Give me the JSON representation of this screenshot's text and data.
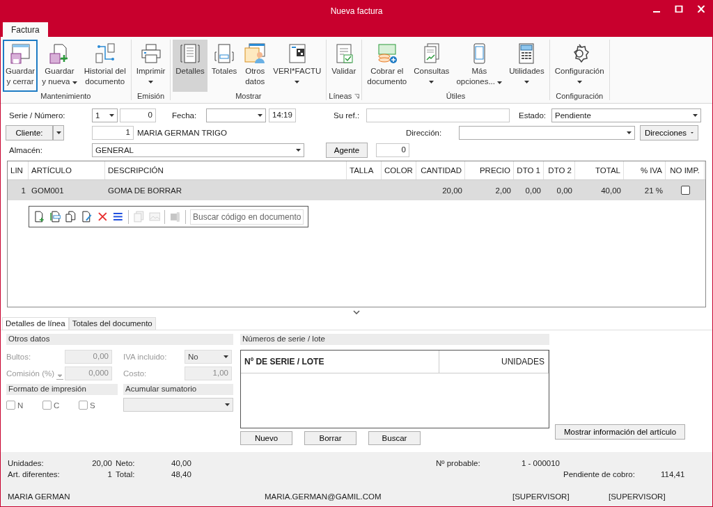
{
  "window": {
    "title": "Nueva factura"
  },
  "ribbon_tabs": [
    {
      "label": "Factura",
      "selected": true
    }
  ],
  "ribbon": [
    {
      "label": "Mantenimiento",
      "launcher": false,
      "buttons": [
        {
          "lines": [
            "Guardar",
            "y cerrar"
          ],
          "menu": false,
          "focused": true,
          "pressed": false
        },
        {
          "lines": [
            "Guardar",
            "y nueva"
          ],
          "menu": true,
          "focused": false,
          "pressed": false
        },
        {
          "lines": [
            "Historial del",
            "documento"
          ],
          "menu": false,
          "focused": false,
          "pressed": false
        }
      ]
    },
    {
      "label": "Emisión",
      "launcher": false,
      "buttons": [
        {
          "lines": [
            "Imprimir"
          ],
          "menu": true,
          "focused": false,
          "pressed": false
        }
      ]
    },
    {
      "label": "Mostrar",
      "launcher": false,
      "buttons": [
        {
          "lines": [
            "Detalles"
          ],
          "menu": false,
          "focused": false,
          "pressed": true
        },
        {
          "lines": [
            "Totales"
          ],
          "menu": false,
          "focused": false,
          "pressed": false
        },
        {
          "lines": [
            "Otros",
            "datos"
          ],
          "menu": false,
          "focused": false,
          "pressed": false
        },
        {
          "lines": [
            "VERI*FACTU"
          ],
          "menu": true,
          "focused": false,
          "pressed": false
        }
      ]
    },
    {
      "label": "Líneas",
      "launcher": true,
      "buttons": [
        {
          "lines": [
            "Validar"
          ],
          "menu": false,
          "focused": false,
          "pressed": false
        }
      ]
    },
    {
      "label": "Útiles",
      "launcher": false,
      "buttons": [
        {
          "lines": [
            "Cobrar el",
            "documento"
          ],
          "menu": false,
          "focused": false,
          "pressed": false
        },
        {
          "lines": [
            "Consultas"
          ],
          "menu": true,
          "focused": false,
          "pressed": false
        },
        {
          "lines": [
            "Más",
            "opciones..."
          ],
          "menu": true,
          "focused": false,
          "pressed": false
        },
        {
          "lines": [
            "Utilidades"
          ],
          "menu": true,
          "focused": false,
          "pressed": false
        }
      ]
    },
    {
      "label": "Configuración",
      "launcher": false,
      "buttons": [
        {
          "lines": [
            "Configuración"
          ],
          "menu": true,
          "focused": false,
          "pressed": false
        }
      ]
    }
  ],
  "header": {
    "serie_label": "Serie / Número:",
    "serie": "1",
    "numero": "0",
    "fecha_label": "Fecha:",
    "hora": "14:19",
    "su_ref_label": "Su ref.:",
    "estado_label": "Estado:",
    "estado": "Pendiente",
    "cliente_button": "Cliente:",
    "cliente_codigo": "1",
    "cliente_nombre": "MARIA GERMAN TRIGO",
    "direccion_label": "Dirección:",
    "direcciones_button": "Direcciones",
    "almacen_label": "Almacén:",
    "almacen": "GENERAL",
    "agente_button": "Agente",
    "agente": "0"
  },
  "lines_table": {
    "columns": [
      {
        "label": "LIN"
      },
      {
        "label": "ARTÍCULO"
      },
      {
        "label": "DESCRIPCIÓN"
      },
      {
        "label": "TALLA"
      },
      {
        "label": "COLOR"
      },
      {
        "label": "CANTIDAD"
      },
      {
        "label": "PRECIO"
      },
      {
        "label": "DTO 1"
      },
      {
        "label": "DTO 2"
      },
      {
        "label": "TOTAL"
      },
      {
        "label": "% IVA"
      },
      {
        "label": "NO IMP."
      }
    ],
    "rows": [
      {
        "lin": "1",
        "articulo": "GOM001",
        "descripcion": "GOMA DE BORRAR",
        "cantidad": "20,00",
        "precio": "2,00",
        "dto_1": "0,00",
        "dto_2": "0,00",
        "total": "40,00",
        "iva": "21 %",
        "no_imp": false,
        "selected": true
      }
    ],
    "tools": [
      {
        "disabled": false
      },
      {
        "disabled": false
      },
      {
        "disabled": false
      },
      {
        "disabled": false
      },
      {
        "disabled": false
      },
      {
        "disabled": false
      },
      {
        "disabled": true
      },
      {
        "disabled": true
      },
      {
        "disabled": true
      }
    ],
    "search": {
      "placeholder": "Buscar código en documento"
    }
  },
  "detail_tabs": [
    {
      "label": "Detalles de línea",
      "selected": true
    },
    {
      "label": "Totales del documento",
      "selected": false
    }
  ],
  "otros_datos": {
    "title": "Otros datos",
    "bultos_label": "Bultos:",
    "bultos": "0,00",
    "iva_label": "IVA incluido:",
    "iva": "No",
    "comision_label": "Comisión (%)",
    "comision": "0,000",
    "costo_label": "Costo:",
    "costo": "1,00"
  },
  "formato": {
    "title": "Formato de impresión",
    "options": [
      {
        "label": "N",
        "checked": false
      },
      {
        "label": "C",
        "checked": false
      },
      {
        "label": "S",
        "checked": false
      }
    ]
  },
  "acumular": {
    "title": "Acumular sumatorio"
  },
  "series": {
    "title": "Números de serie / lote",
    "columns": [
      "Nº DE SERIE / LOTE",
      "UNIDADES"
    ],
    "buttons": [
      "Nuevo",
      "Borrar",
      "Buscar"
    ]
  },
  "info_button": "Mostrar información del artículo",
  "summary": {
    "unidades_label": "Unidades:",
    "unidades": "20,00",
    "neto_label": "Neto:",
    "neto": "40,00",
    "art_label": "Art. diferentes:",
    "art": "1",
    "total_label": "Total:",
    "total": "48,40",
    "probable_label": "Nº probable:",
    "probable": "1 - 000010",
    "pendiente_label": "Pendiente de cobro:",
    "pendiente": "114,41"
  },
  "status_bar": [
    "MARIA GERMAN",
    "MARIA.GERMAN@GAMIL.COM",
    "[SUPERVISOR]",
    "[SUPERVISOR]"
  ]
}
